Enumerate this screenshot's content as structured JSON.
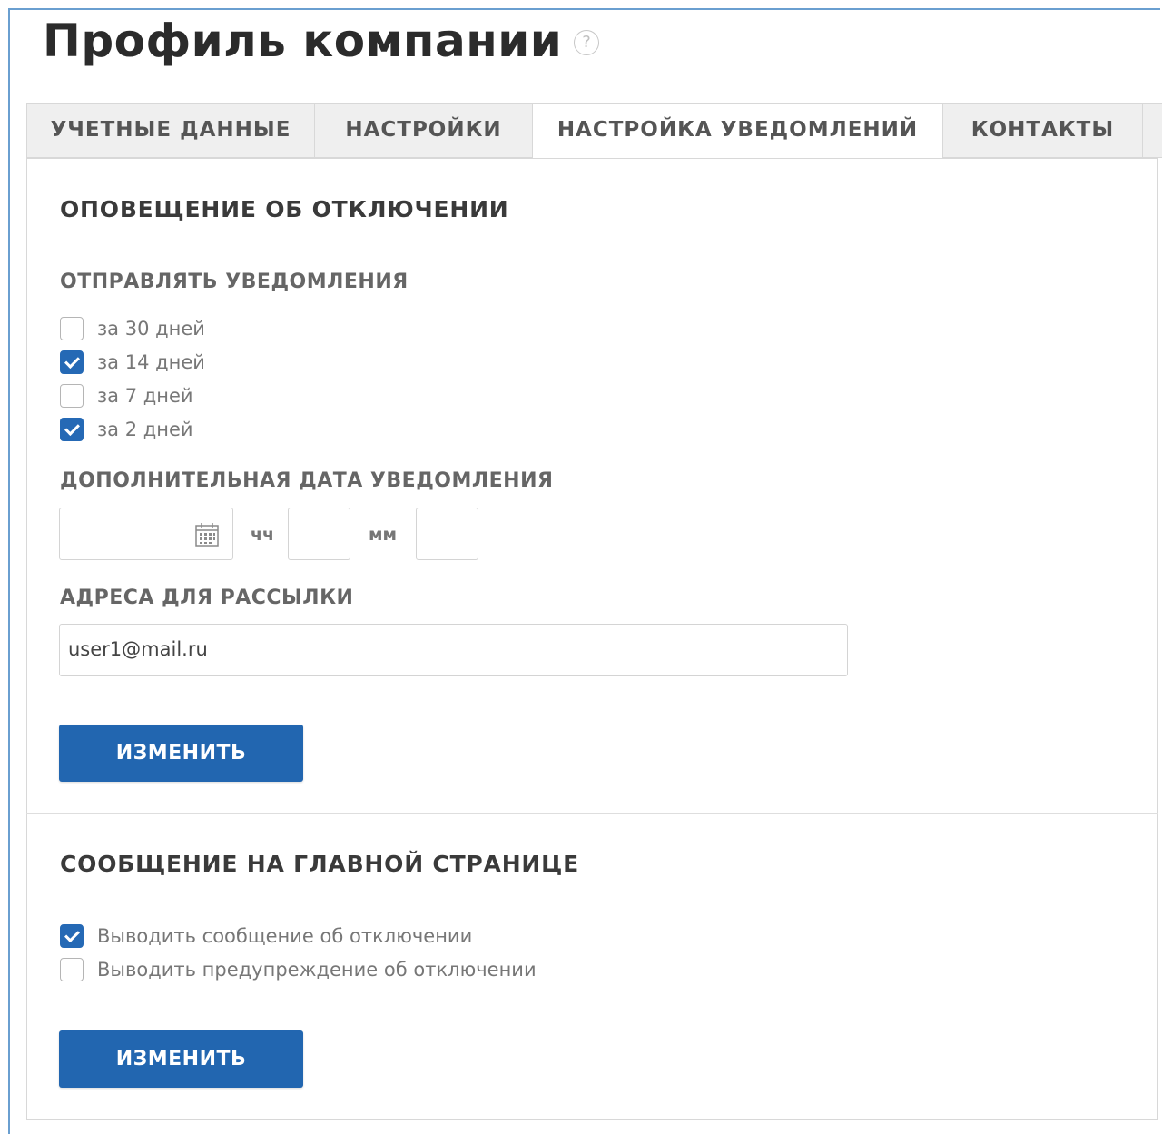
{
  "page": {
    "title": "Профиль компании",
    "help_glyph": "?"
  },
  "tabs": [
    {
      "label": "УЧЕТНЫЕ ДАННЫЕ",
      "active": false
    },
    {
      "label": "НАСТРОЙКИ",
      "active": false
    },
    {
      "label": "НАСТРОЙКА УВЕДОМЛЕНИЙ",
      "active": true
    },
    {
      "label": "КОНТАКТЫ",
      "active": false
    }
  ],
  "shutdown_notice": {
    "title": "ОПОВЕЩЕНИЕ ОБ ОТКЛЮЧЕНИИ",
    "send_label": "ОТПРАВЛЯТЬ УВЕДОМЛЕНИЯ",
    "options": [
      {
        "label": "за 30 дней",
        "checked": false
      },
      {
        "label": "за 14 дней",
        "checked": true
      },
      {
        "label": "за 7 дней",
        "checked": false
      },
      {
        "label": "за 2 дней",
        "checked": true
      }
    ],
    "extra_date_label": "ДОПОЛНИТЕЛЬНАЯ ДАТА УВЕДОМЛЕНИЯ",
    "date_value": "",
    "hours_label": "чч",
    "hours_value": "",
    "minutes_label": "мм",
    "minutes_value": "",
    "addresses_label": "АДРЕСА ДЛЯ РАССЫЛКИ",
    "addresses_value": "user1@mail.ru",
    "submit_label": "ИЗМЕНИТЬ"
  },
  "main_page_message": {
    "title": "СООБЩЕНИЕ НА ГЛАВНОЙ СТРАНИЦЕ",
    "options": [
      {
        "label": "Выводить сообщение об отключении",
        "checked": true
      },
      {
        "label": "Выводить предупреждение об отключении",
        "checked": false
      }
    ],
    "submit_label": "ИЗМЕНИТЬ"
  },
  "colors": {
    "primary_button": "#2266b0",
    "checkbox_checked": "#2569b5",
    "frame_border": "#6a9fd0"
  },
  "icons": {
    "help": "help-icon",
    "calendar": "calendar-icon",
    "checkmark": "checkmark-icon"
  }
}
